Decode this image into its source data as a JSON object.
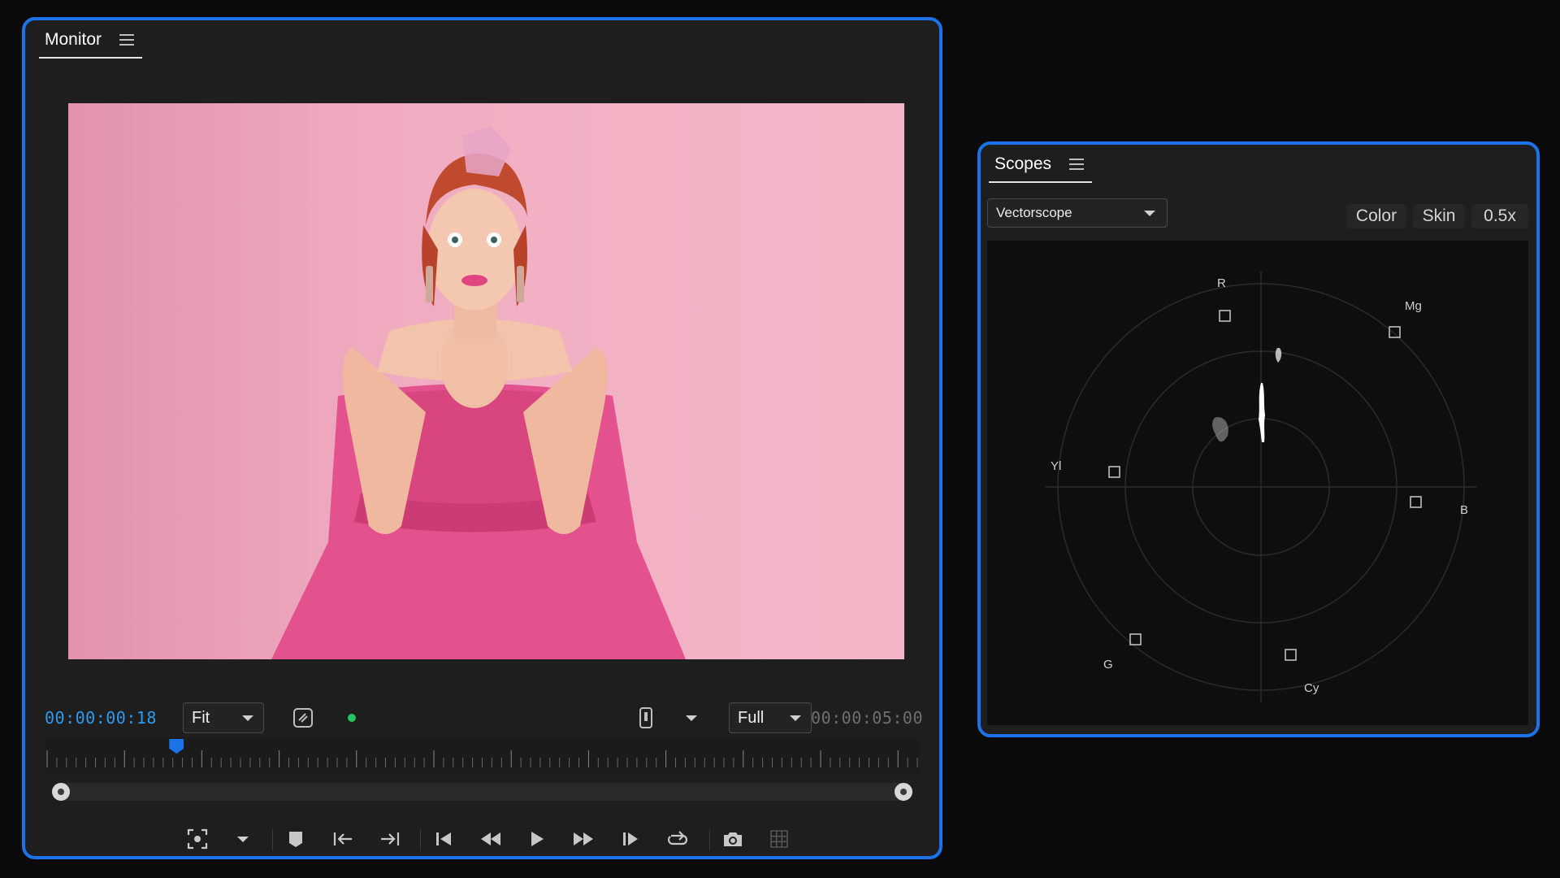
{
  "monitor": {
    "tab_label": "Monitor",
    "current_timecode": "00:00:00:18",
    "total_timecode": "00:00:05:00",
    "zoom_select": "Fit",
    "quality_select": "Full",
    "playhead_fraction": 0.15
  },
  "scopes": {
    "tab_label": "Scopes",
    "scope_type": "Vectorscope",
    "buttons": {
      "color": "Color",
      "skin": "Skin",
      "zoom": "0.5x"
    },
    "vectorscope_labels": {
      "r": "R",
      "mg": "Mg",
      "b": "B",
      "cy": "Cy",
      "g": "G",
      "yl": "Yl"
    }
  },
  "colors": {
    "accent": "#1a73e8",
    "timecode": "#2d9bf0",
    "status_dot": "#22c55e",
    "panel": "#1e1e1f"
  }
}
